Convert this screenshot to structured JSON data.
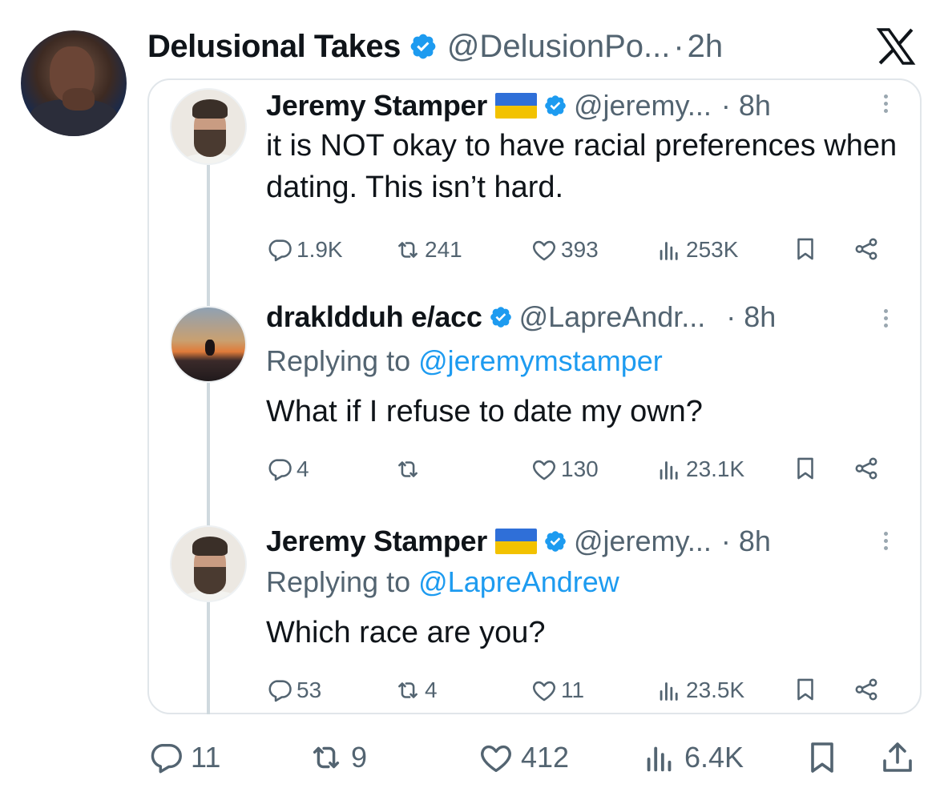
{
  "post": {
    "author_name": "Delusional Takes",
    "handle": "@DelusionPo...",
    "separator": "·",
    "time": "2h",
    "brand_icon": "x-logo-icon",
    "stats": {
      "replies": "11",
      "reposts": "9",
      "likes": "412",
      "views": "6.4K"
    }
  },
  "thread": [
    {
      "author_name": "Jeremy Stamper",
      "flag": "ukraine-flag-icon",
      "handle": "@jeremy...",
      "time": "· 8h",
      "replying_prefix": "",
      "replying_to": "",
      "text": "it is NOT okay to have racial preferences when dating. This isn’t hard.",
      "stats": {
        "replies": "1.9K",
        "reposts": "241",
        "likes": "393",
        "views": "253K"
      }
    },
    {
      "author_name": "drakldduh e/acc",
      "handle": "@LapreAndr...",
      "time": "· 8h",
      "replying_prefix": "Replying to",
      "replying_to": "@jeremymstamper",
      "text": "What if I refuse to date my own?",
      "stats": {
        "replies": "4",
        "reposts": "",
        "likes": "130",
        "views": "23.1K"
      }
    },
    {
      "author_name": "Jeremy Stamper",
      "flag": "ukraine-flag-icon",
      "handle": "@jeremy...",
      "time": "· 8h",
      "replying_prefix": "Replying to",
      "replying_to": "@LapreAndrew",
      "text": "Which race are you?",
      "stats": {
        "replies": "53",
        "reposts": "4",
        "likes": "11",
        "views": "23.5K"
      }
    }
  ],
  "colors": {
    "link": "#1d9bf0",
    "verified": "#1d9bf0",
    "muted": "#536471",
    "text": "#0f1419"
  }
}
